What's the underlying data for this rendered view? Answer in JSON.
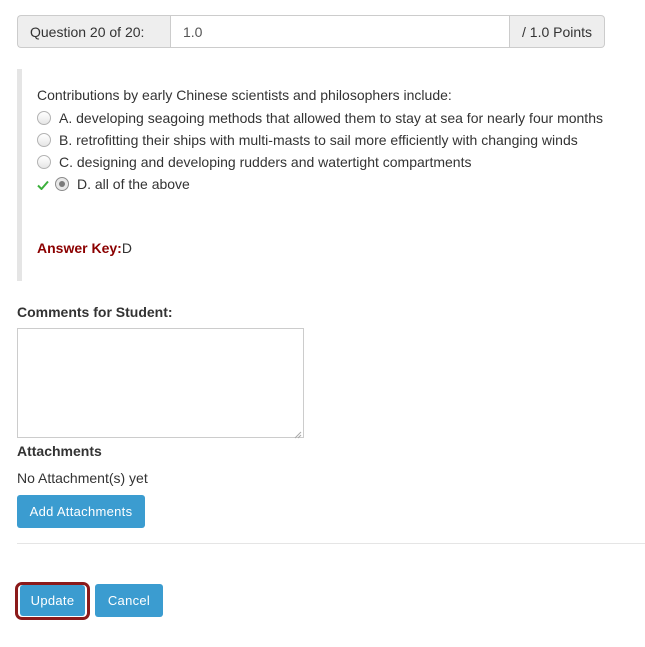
{
  "score": {
    "question_label": "Question 20 of 20:",
    "value": "1.0",
    "points_label": "/ 1.0 Points"
  },
  "question": {
    "text": "Contributions by early Chinese scientists and philosophers include:",
    "answers": [
      {
        "label": "A. developing seagoing methods that allowed them to stay at sea for nearly four months",
        "selected": false
      },
      {
        "label": "B. retrofitting their ships with multi-masts to sail more efficiently with changing winds",
        "selected": false
      },
      {
        "label": "C. designing and developing rudders and watertight compartments",
        "selected": false
      },
      {
        "label": "D. all of the above",
        "selected": true
      }
    ],
    "answer_key_label": "Answer Key:",
    "answer_key_value": "D"
  },
  "comments": {
    "label": "Comments for Student:",
    "value": ""
  },
  "attachments": {
    "title": "Attachments",
    "empty_text": "No Attachment(s) yet",
    "add_button": "Add Attachments"
  },
  "actions": {
    "update": "Update",
    "cancel": "Cancel"
  },
  "colors": {
    "button": "#3b9cd0",
    "answer_key": "#8b0000",
    "highlight_ring": "#8b1a1a",
    "correct_check": "#3bb03b"
  }
}
